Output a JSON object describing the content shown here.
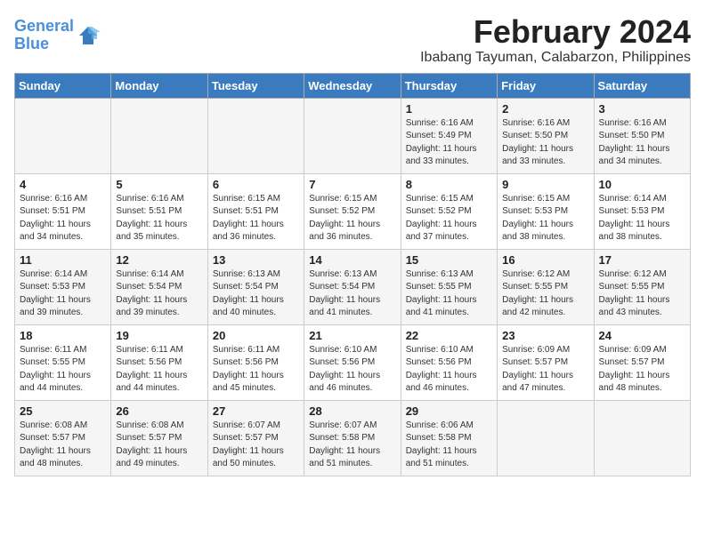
{
  "logo": {
    "line1": "General",
    "line2": "Blue"
  },
  "title": "February 2024",
  "subtitle": "Ibabang Tayuman, Calabarzon, Philippines",
  "days_of_week": [
    "Sunday",
    "Monday",
    "Tuesday",
    "Wednesday",
    "Thursday",
    "Friday",
    "Saturday"
  ],
  "weeks": [
    [
      {
        "day": "",
        "info": ""
      },
      {
        "day": "",
        "info": ""
      },
      {
        "day": "",
        "info": ""
      },
      {
        "day": "",
        "info": ""
      },
      {
        "day": "1",
        "info": "Sunrise: 6:16 AM\nSunset: 5:49 PM\nDaylight: 11 hours\nand 33 minutes."
      },
      {
        "day": "2",
        "info": "Sunrise: 6:16 AM\nSunset: 5:50 PM\nDaylight: 11 hours\nand 33 minutes."
      },
      {
        "day": "3",
        "info": "Sunrise: 6:16 AM\nSunset: 5:50 PM\nDaylight: 11 hours\nand 34 minutes."
      }
    ],
    [
      {
        "day": "4",
        "info": "Sunrise: 6:16 AM\nSunset: 5:51 PM\nDaylight: 11 hours\nand 34 minutes."
      },
      {
        "day": "5",
        "info": "Sunrise: 6:16 AM\nSunset: 5:51 PM\nDaylight: 11 hours\nand 35 minutes."
      },
      {
        "day": "6",
        "info": "Sunrise: 6:15 AM\nSunset: 5:51 PM\nDaylight: 11 hours\nand 36 minutes."
      },
      {
        "day": "7",
        "info": "Sunrise: 6:15 AM\nSunset: 5:52 PM\nDaylight: 11 hours\nand 36 minutes."
      },
      {
        "day": "8",
        "info": "Sunrise: 6:15 AM\nSunset: 5:52 PM\nDaylight: 11 hours\nand 37 minutes."
      },
      {
        "day": "9",
        "info": "Sunrise: 6:15 AM\nSunset: 5:53 PM\nDaylight: 11 hours\nand 38 minutes."
      },
      {
        "day": "10",
        "info": "Sunrise: 6:14 AM\nSunset: 5:53 PM\nDaylight: 11 hours\nand 38 minutes."
      }
    ],
    [
      {
        "day": "11",
        "info": "Sunrise: 6:14 AM\nSunset: 5:53 PM\nDaylight: 11 hours\nand 39 minutes."
      },
      {
        "day": "12",
        "info": "Sunrise: 6:14 AM\nSunset: 5:54 PM\nDaylight: 11 hours\nand 39 minutes."
      },
      {
        "day": "13",
        "info": "Sunrise: 6:13 AM\nSunset: 5:54 PM\nDaylight: 11 hours\nand 40 minutes."
      },
      {
        "day": "14",
        "info": "Sunrise: 6:13 AM\nSunset: 5:54 PM\nDaylight: 11 hours\nand 41 minutes."
      },
      {
        "day": "15",
        "info": "Sunrise: 6:13 AM\nSunset: 5:55 PM\nDaylight: 11 hours\nand 41 minutes."
      },
      {
        "day": "16",
        "info": "Sunrise: 6:12 AM\nSunset: 5:55 PM\nDaylight: 11 hours\nand 42 minutes."
      },
      {
        "day": "17",
        "info": "Sunrise: 6:12 AM\nSunset: 5:55 PM\nDaylight: 11 hours\nand 43 minutes."
      }
    ],
    [
      {
        "day": "18",
        "info": "Sunrise: 6:11 AM\nSunset: 5:55 PM\nDaylight: 11 hours\nand 44 minutes."
      },
      {
        "day": "19",
        "info": "Sunrise: 6:11 AM\nSunset: 5:56 PM\nDaylight: 11 hours\nand 44 minutes."
      },
      {
        "day": "20",
        "info": "Sunrise: 6:11 AM\nSunset: 5:56 PM\nDaylight: 11 hours\nand 45 minutes."
      },
      {
        "day": "21",
        "info": "Sunrise: 6:10 AM\nSunset: 5:56 PM\nDaylight: 11 hours\nand 46 minutes."
      },
      {
        "day": "22",
        "info": "Sunrise: 6:10 AM\nSunset: 5:56 PM\nDaylight: 11 hours\nand 46 minutes."
      },
      {
        "day": "23",
        "info": "Sunrise: 6:09 AM\nSunset: 5:57 PM\nDaylight: 11 hours\nand 47 minutes."
      },
      {
        "day": "24",
        "info": "Sunrise: 6:09 AM\nSunset: 5:57 PM\nDaylight: 11 hours\nand 48 minutes."
      }
    ],
    [
      {
        "day": "25",
        "info": "Sunrise: 6:08 AM\nSunset: 5:57 PM\nDaylight: 11 hours\nand 48 minutes."
      },
      {
        "day": "26",
        "info": "Sunrise: 6:08 AM\nSunset: 5:57 PM\nDaylight: 11 hours\nand 49 minutes."
      },
      {
        "day": "27",
        "info": "Sunrise: 6:07 AM\nSunset: 5:57 PM\nDaylight: 11 hours\nand 50 minutes."
      },
      {
        "day": "28",
        "info": "Sunrise: 6:07 AM\nSunset: 5:58 PM\nDaylight: 11 hours\nand 51 minutes."
      },
      {
        "day": "29",
        "info": "Sunrise: 6:06 AM\nSunset: 5:58 PM\nDaylight: 11 hours\nand 51 minutes."
      },
      {
        "day": "",
        "info": ""
      },
      {
        "day": "",
        "info": ""
      }
    ]
  ]
}
